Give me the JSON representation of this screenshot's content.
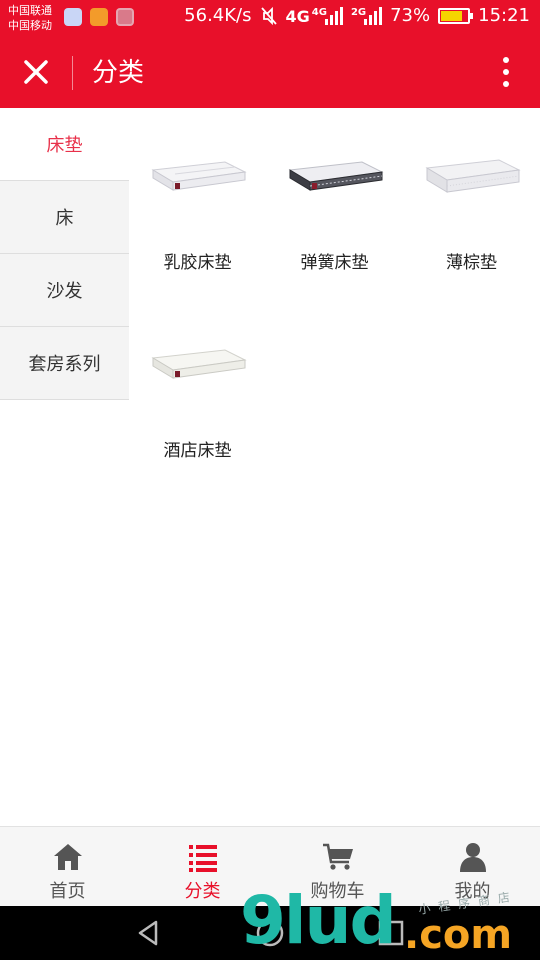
{
  "statusbar": {
    "carrier_1": "中国联通",
    "carrier_2": "中国移动",
    "net_speed": "56.4K/s",
    "network_4g": "4G",
    "network_4g_small": "4G",
    "network_2g": "2G",
    "battery_percent": "73%",
    "battery_level": 0.73,
    "time": "15:21"
  },
  "appbar": {
    "title": "分类",
    "close_icon": "close-icon",
    "more_icon": "more-vertical-icon"
  },
  "sidebar": {
    "items": [
      {
        "label": "床垫",
        "active": true
      },
      {
        "label": "床",
        "active": false
      },
      {
        "label": "沙发",
        "active": false
      },
      {
        "label": "套房系列",
        "active": false
      }
    ]
  },
  "products": [
    {
      "label": "乳胶床垫",
      "image": "mattress-latex-image"
    },
    {
      "label": "弹簧床垫",
      "image": "mattress-spring-image"
    },
    {
      "label": "薄棕垫",
      "image": "mattress-thin-palm-image"
    },
    {
      "label": "酒店床垫",
      "image": "mattress-hotel-image"
    }
  ],
  "tabbar": {
    "tabs": [
      {
        "label": "首页",
        "icon": "home-icon",
        "active": false
      },
      {
        "label": "分类",
        "icon": "list-icon",
        "active": true
      },
      {
        "label": "购物车",
        "icon": "cart-icon",
        "active": false
      },
      {
        "label": "我的",
        "icon": "user-icon",
        "active": false
      }
    ]
  },
  "watermark": {
    "number": "9lud",
    "domain": ".com",
    "subtitle": "小程序商店"
  },
  "colors": {
    "brand_red": "#e8102a",
    "active_text": "#e8314a",
    "watermark_teal": "#1fb8a6",
    "watermark_orange": "#f5a524"
  }
}
